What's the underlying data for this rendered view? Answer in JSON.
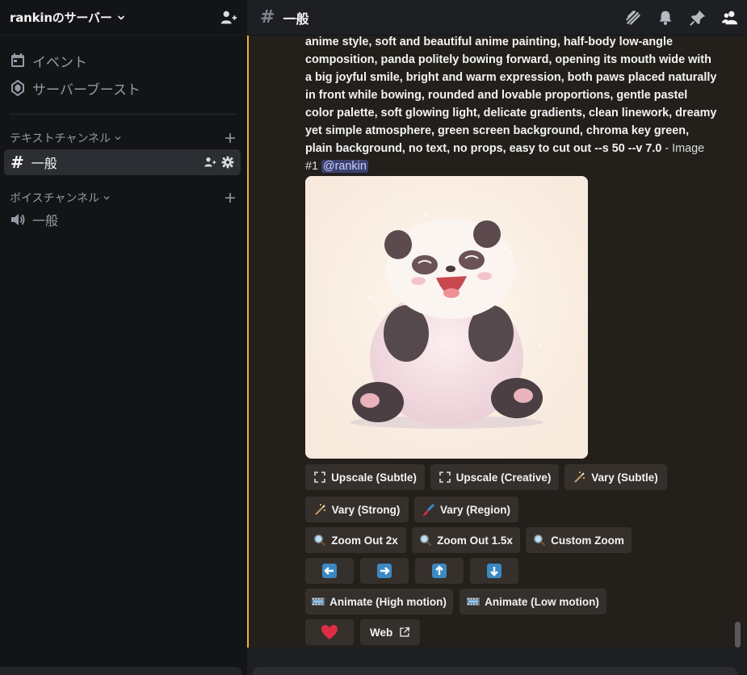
{
  "server": {
    "name": "rankinのサーバー"
  },
  "sidebar": {
    "top_items": [
      {
        "label": "イベント",
        "icon": "calendar-icon"
      },
      {
        "label": "サーバーブースト",
        "icon": "boost-icon"
      }
    ],
    "text_category": "テキストチャンネル",
    "text_channels": [
      {
        "label": "一般",
        "active": true
      }
    ],
    "voice_category": "ボイスチャンネル",
    "voice_channels": [
      {
        "label": "一般"
      }
    ]
  },
  "header": {
    "hash": "#",
    "channel": "一般"
  },
  "message": {
    "prompt": "anime style, soft and beautiful anime painting, half-body low-angle composition, panda politely bowing forward, opening its mouth wide with a big joyful smile, bright and warm expression, both paws placed naturally in front while bowing, rounded and lovable proportions, gentle pastel color palette, soft glowing light, delicate gradients, clean linework, dreamy yet simple atmosphere, green screen background, chroma key green, plain background, no text, no props, easy to cut out --s 50 --v 7.0",
    "suffix": " - Image #1 ",
    "mention": "@rankin"
  },
  "buttons": {
    "upscale_subtle": "Upscale (Subtle)",
    "upscale_creative": "Upscale (Creative)",
    "vary_subtle": "Vary (Subtle)",
    "vary_strong": "Vary (Strong)",
    "vary_region": "Vary (Region)",
    "zoom_out_2x": "Zoom Out 2x",
    "zoom_out_1_5x": "Zoom Out 1.5x",
    "custom_zoom": "Custom Zoom",
    "animate_high": "Animate (High motion)",
    "animate_low": "Animate (Low motion)",
    "web": "Web"
  },
  "colors": {
    "accent": "#f0b232",
    "mention_bg": "#3c4270",
    "arrow_blue": "#3b88c3",
    "heart": "#dd2e44"
  }
}
